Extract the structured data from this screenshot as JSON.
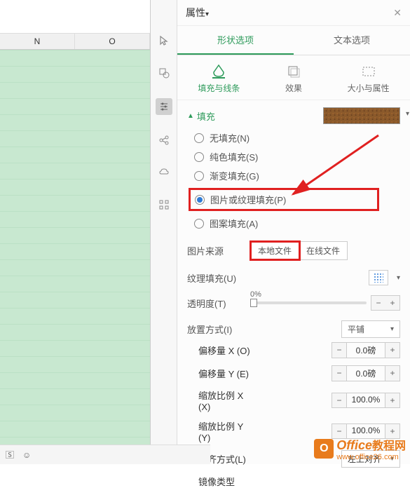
{
  "sheet": {
    "cols": [
      "N",
      "O"
    ]
  },
  "panel": {
    "title": "属性",
    "tabs": {
      "shape": "形状选项",
      "text": "文本选项"
    },
    "subtabs": {
      "fill": "填充与线条",
      "effect": "效果",
      "size": "大小与属性"
    }
  },
  "fill": {
    "section_title": "填充",
    "options": {
      "none": "无填充(N)",
      "solid": "纯色填充(S)",
      "gradient": "渐变填充(G)",
      "picture": "图片或纹理填充(P)",
      "pattern": "图案填充(A)"
    }
  },
  "picture_src": {
    "label": "图片来源",
    "local": "本地文件",
    "online": "在线文件"
  },
  "texture": {
    "label": "纹理填充(U)"
  },
  "opacity": {
    "label": "透明度(T)",
    "value": "0%"
  },
  "tile": {
    "label": "放置方式(I)",
    "value": "平铺"
  },
  "offset_x": {
    "label": "偏移量 X (O)",
    "value": "0.0磅"
  },
  "offset_y": {
    "label": "偏移量 Y (E)",
    "value": "0.0磅"
  },
  "scale_x": {
    "label": "缩放比例 X (X)",
    "value": "100.0%"
  },
  "scale_y": {
    "label": "缩放比例 Y (Y)",
    "value": "100.0%"
  },
  "align": {
    "label": "对齐方式(L)",
    "value": "左上对齐"
  },
  "mirror": {
    "label": "镜像类型"
  },
  "watermark": {
    "brand": "Office",
    "suffix": "教程网",
    "url": "www.office26.com"
  }
}
